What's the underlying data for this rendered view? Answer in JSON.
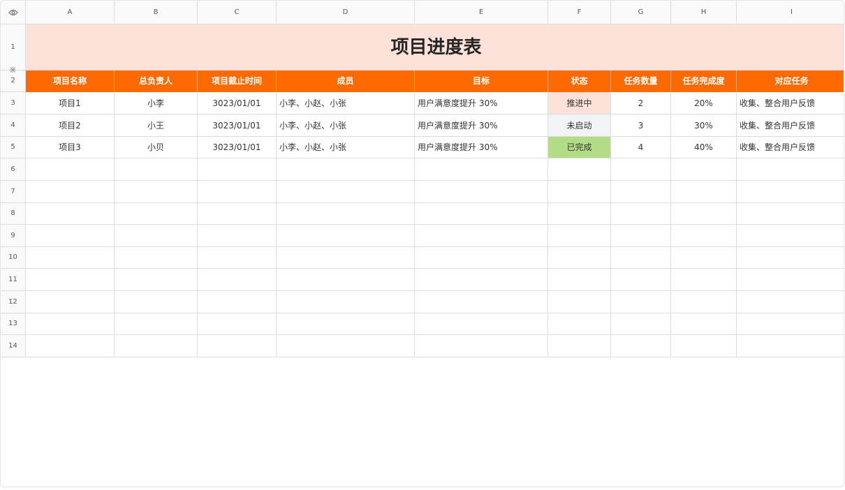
{
  "columns": [
    "A",
    "B",
    "C",
    "D",
    "E",
    "F",
    "G",
    "H",
    "I"
  ],
  "rows": [
    "1",
    "2",
    "3",
    "4",
    "5",
    "6",
    "7",
    "8",
    "9",
    "10",
    "11",
    "12",
    "13",
    "14"
  ],
  "title": "项目进度表",
  "headers": [
    "项目名称",
    "总负责人",
    "项目截止时间",
    "成员",
    "目标",
    "状态",
    "任务数量",
    "任务完成度",
    "对应任务"
  ],
  "records": [
    [
      "项目1",
      "小李",
      "3023/01/01",
      "小李、小赵、小张",
      "用户满意度提升 30%",
      "推进中",
      "2",
      "20%",
      "收集、整合用户反馈"
    ],
    [
      "项目2",
      "小王",
      "3023/01/01",
      "小李、小赵、小张",
      "用户满意度提升 30%",
      "未启动",
      "3",
      "30%",
      "收集、整合用户反馈"
    ],
    [
      "项目3",
      "小贝",
      "3023/01/01",
      "小李、小赵、小张",
      "用户满意度提升 30%",
      "已完成",
      "4",
      "40%",
      "收集、整合用户反馈"
    ]
  ],
  "status_colors": {
    "推进中": "#fde2d9",
    "未启动": "#f2f3f5",
    "已完成": "#b2dd86"
  },
  "colors": {
    "header_bg": "#ff6a00",
    "title_bg": "#fde2d9",
    "grid": "#dddddd"
  },
  "icons": {
    "corner": "eye-icon",
    "freeze": "freeze-handle-icon"
  }
}
